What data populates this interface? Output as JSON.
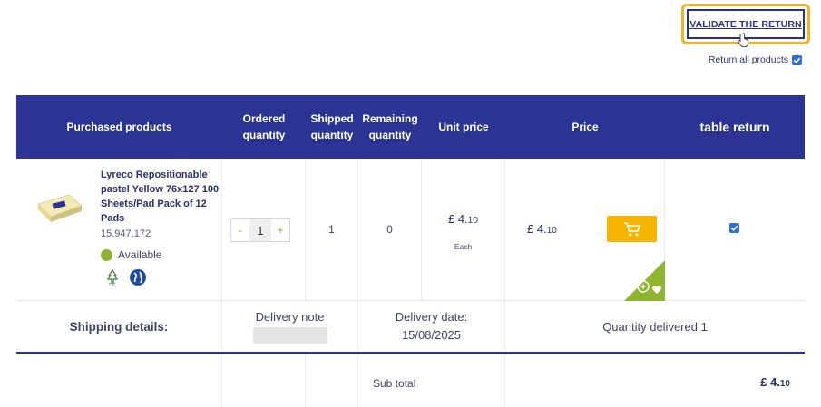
{
  "header": {
    "validate_label": "VALIDATE THE RETURN",
    "return_all_label": "Return all products",
    "return_all_checked": true
  },
  "table": {
    "columns": [
      "Purchased products",
      "Ordered quantity",
      "Shipped quantity",
      "Remaining quantity",
      "Unit price",
      "Price",
      "table return"
    ]
  },
  "product": {
    "name": "Lyreco Repositionable pastel Yellow 76x127 100 Sheets/Pad Pack of 12 Pads",
    "reference": "15.947.172",
    "availability": "Available",
    "ordered_qty": "1",
    "decrement": "-",
    "increment": "+",
    "shipped_qty": "1",
    "remaining_qty": "0",
    "unit_price_main": "£ 4.",
    "unit_price_cents": "10",
    "unit_label": "Each",
    "price_main": "£ 4.",
    "price_cents": "10",
    "return_checked": true
  },
  "shipping": {
    "label": "Shipping details:",
    "delivery_note_label": "Delivery note",
    "delivery_date_label": "Delivery date:",
    "delivery_date": "15/08/2025",
    "quantity_delivered": "Quantity delivered 1"
  },
  "subtotal": {
    "label": "Sub total",
    "value_main": "£ 4.",
    "value_cents": "10"
  },
  "colors": {
    "header_bg": "#2b3494",
    "accent_yellow": "#f5b400",
    "highlight_border": "#f0b429",
    "available_green": "#8db530"
  }
}
